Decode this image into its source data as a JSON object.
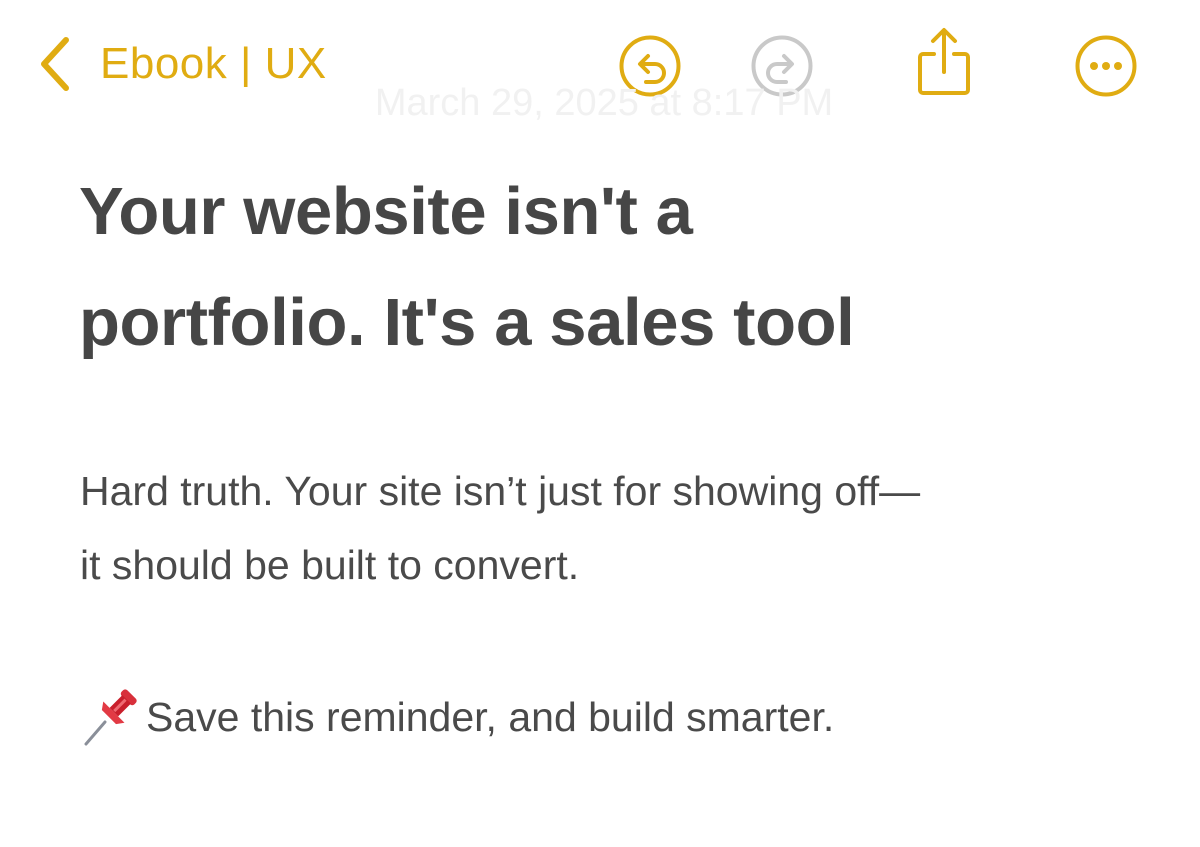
{
  "nav": {
    "back_label": "Ebook | UX",
    "accent_color": "#e0ac12",
    "icons": [
      "undo-icon",
      "redo-icon",
      "share-icon",
      "more-icon"
    ]
  },
  "note": {
    "date_ghost": "March 29, 2025 at 8:17 PM",
    "title_line_1": "Your website isn't a",
    "title_line_2": "portfolio. It's a sales tool",
    "body_line_1": "Hard truth. Your site isn’t just for showing off—",
    "body_line_2": "it should be built to convert.",
    "pin_icon": "pushpin-icon",
    "reminder": "Save this reminder, and build smarter."
  }
}
